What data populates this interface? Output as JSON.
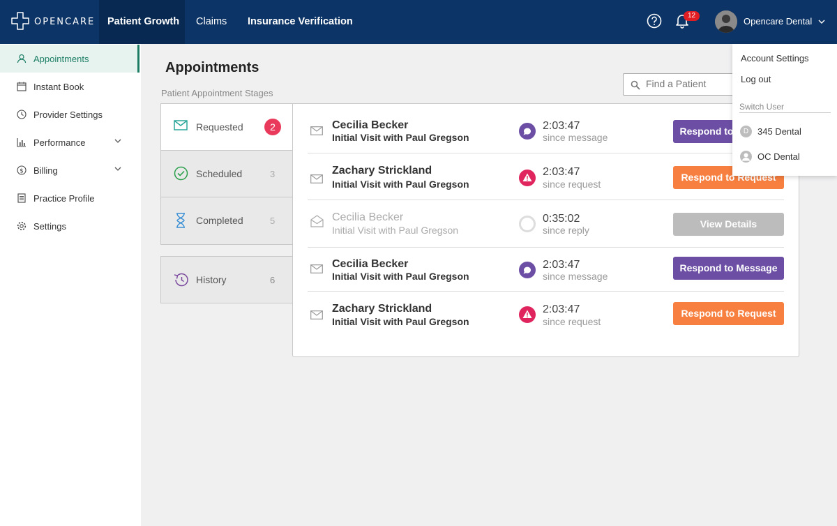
{
  "brand": {
    "logo_text": "OPENCARE"
  },
  "topnav": {
    "tabs": [
      {
        "label": "Patient Growth"
      },
      {
        "label": "Claims"
      },
      {
        "label": "Insurance Verification"
      }
    ],
    "notifications_count": "12",
    "account_name": "Opencare Dental"
  },
  "sidebar": {
    "items": [
      {
        "label": "Appointments",
        "icon": "user-icon"
      },
      {
        "label": "Instant Book",
        "icon": "calendar-icon"
      },
      {
        "label": "Provider Settings",
        "icon": "clock-icon"
      },
      {
        "label": "Performance",
        "icon": "bar-chart-icon"
      },
      {
        "label": "Billing",
        "icon": "dollar-icon"
      },
      {
        "label": "Practice Profile",
        "icon": "document-icon"
      },
      {
        "label": "Settings",
        "icon": "gear-icon"
      }
    ]
  },
  "main": {
    "title": "Appointments",
    "stages_label": "Patient Appointment Stages",
    "search_placeholder": "Find a Patient",
    "stages": [
      {
        "label": "Requested",
        "count": "2"
      },
      {
        "label": "Scheduled",
        "count": "3"
      },
      {
        "label": "Completed",
        "count": "5"
      }
    ],
    "history": {
      "label": "History",
      "count": "6"
    },
    "appointments": [
      {
        "name": "Cecilia Becker",
        "visit": "Initial Visit with Paul Gregson",
        "time": "2:03:47",
        "since": "since message",
        "status_icon": "chat-icon",
        "button": "Respond to Message",
        "button_color": "#6c4fa5"
      },
      {
        "name": "Zachary Strickland",
        "visit": "Initial Visit with Paul Gregson",
        "time": "2:03:47",
        "since": "since request",
        "status_icon": "alert-icon",
        "button": "Respond to Request",
        "button_color": "#f77f3f"
      },
      {
        "name": "Cecilia Becker",
        "visit": "Initial Visit with Paul Gregson",
        "time": "0:35:02",
        "since": "since reply",
        "status_icon": "empty-circle-icon",
        "button": "View Details",
        "button_color": "#bcbcbc"
      },
      {
        "name": "Cecilia Becker",
        "visit": "Initial Visit with Paul Gregson",
        "time": "2:03:47",
        "since": "since message",
        "status_icon": "chat-icon",
        "button": "Respond to Message",
        "button_color": "#6c4fa5"
      },
      {
        "name": "Zachary Strickland",
        "visit": "Initial Visit with Paul Gregson",
        "time": "2:03:47",
        "since": "since request",
        "status_icon": "alert-icon",
        "button": "Respond to Request",
        "button_color": "#f77f3f"
      }
    ]
  },
  "account_menu": {
    "account_settings": "Account Settings",
    "log_out": "Log out",
    "switch_user_label": "Switch User",
    "users": [
      {
        "initial": "D",
        "label": "345 Dental"
      },
      {
        "label": "OC Dental"
      }
    ]
  },
  "colors": {
    "topbar": "#0d3466",
    "accent_green": "#1b7d64",
    "purple": "#6c4fa5",
    "orange": "#f77f3f",
    "alert_red": "#ea3a5c"
  }
}
